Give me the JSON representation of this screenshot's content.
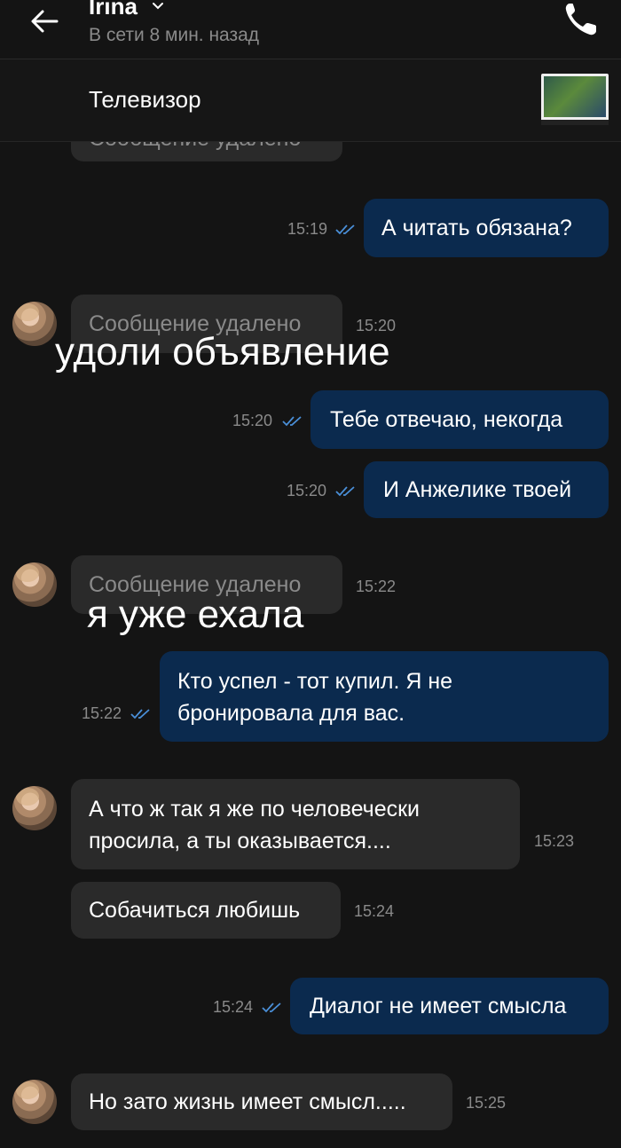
{
  "header": {
    "contact_name": "Irina",
    "status": "В сети 8 мин. назад"
  },
  "ad": {
    "title": "Телевизор"
  },
  "messages": {
    "m0": {
      "text": "Сообщение удалено"
    },
    "m1": {
      "text": "А читать обязана?",
      "time": "15:19"
    },
    "m2": {
      "text": "Сообщение удалено",
      "time": "15:20"
    },
    "m3": {
      "text": "Тебе отвечаю, некогда",
      "time": "15:20"
    },
    "m4": {
      "text": "И Анжелике твоей",
      "time": "15:20"
    },
    "m5": {
      "text": "Сообщение удалено",
      "time": "15:22"
    },
    "m6": {
      "line1": "Кто успел - тот купил. Я не",
      "line2": "бронировала для вас.",
      "time": "15:22"
    },
    "m7": {
      "line1": "А что ж так я же по человечески",
      "line2": "просила, а ты оказывается....",
      "time": "15:23"
    },
    "m8": {
      "text": "Собачиться любишь",
      "time": "15:24"
    },
    "m9": {
      "text": "Диалог не имеет смысла",
      "time": "15:24"
    },
    "m10": {
      "text": "Но зато жизнь имеет смысл.....",
      "time": "15:25"
    }
  },
  "overlays": {
    "caption1": "удоли объявление",
    "caption2": "я уже ехала"
  },
  "colors": {
    "background": "#141414",
    "incoming_bubble": "#2a2a2a",
    "outgoing_bubble": "#0b2a4e",
    "read_ticks": "#4a8fd8"
  },
  "icons": {
    "back": "arrow-left",
    "call": "phone",
    "chevron": "chevron-down",
    "read_status": "double-check"
  }
}
